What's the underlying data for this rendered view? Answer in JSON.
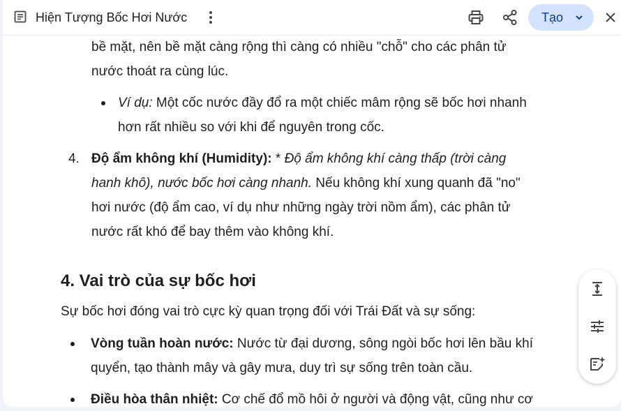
{
  "header": {
    "title": "Hiện Tượng Bốc Hơi Nước",
    "create_label": "Tạo",
    "icons": [
      "document-icon",
      "more-vertical-icon",
      "print-icon",
      "share-icon",
      "chevron-down-icon",
      "close-icon"
    ]
  },
  "content": {
    "para_top_1": "bề mặt, nên bề mặt càng rộng thì càng có nhiều \"chỗ\" cho các phân tử",
    "para_top_2": "nước thoát ra cùng lúc.",
    "example_label": "Ví dụ:",
    "example_1": " Một cốc nước đầy đổ ra một chiếc mâm rộng sẽ bốc hơi nhanh",
    "example_2": "hơn rất nhiều so với khi để nguyên trong cốc.",
    "item4_number": "4.",
    "item4_bold": "Độ ẩm không khí (Humidity):",
    "item4_star": " * ",
    "item4_italic_1": "Độ ẩm không khí càng thấp (trời càng",
    "item4_italic_2": "hanh khô), nước bốc hơi càng nhanh.",
    "item4_rest_2": " Nếu không khí xung quanh đã \"no\"",
    "item4_line_3": "hơi nước (độ ẩm cao, ví dụ như những ngày trời nồm ẩm), các phân tử",
    "item4_line_4": "nước rất khó để bay thêm vào không khí.",
    "section_heading": "4. Vai trò của sự bốc hơi",
    "section_intro": "Sự bốc hơi đóng vai trò cực kỳ quan trọng đối với Trái Đất và sự sống:",
    "bullet1_bold": "Vòng tuần hoàn nước:",
    "bullet1_text": " Nước từ đại dương, sông ngòi bốc hơi lên bầu khí",
    "bullet1_line_2": "quyển, tạo thành mây và gây mưa, duy trì sự sống trên toàn cầu.",
    "bullet2_bold": "Điều hòa thân nhiệt:",
    "bullet2_text": " Cơ chế đổ mồ hôi ở người và động vật, cũng như cơ"
  },
  "floating_toolbar": {
    "icons": [
      "expand-height-icon",
      "tune-icon",
      "add-notes-icon"
    ]
  },
  "colors": {
    "background": "#f0f4f9",
    "panel": "#ffffff",
    "text": "#1f1f1f",
    "create_button_bg": "#d3e3fd",
    "create_button_text": "#0b3d91"
  }
}
